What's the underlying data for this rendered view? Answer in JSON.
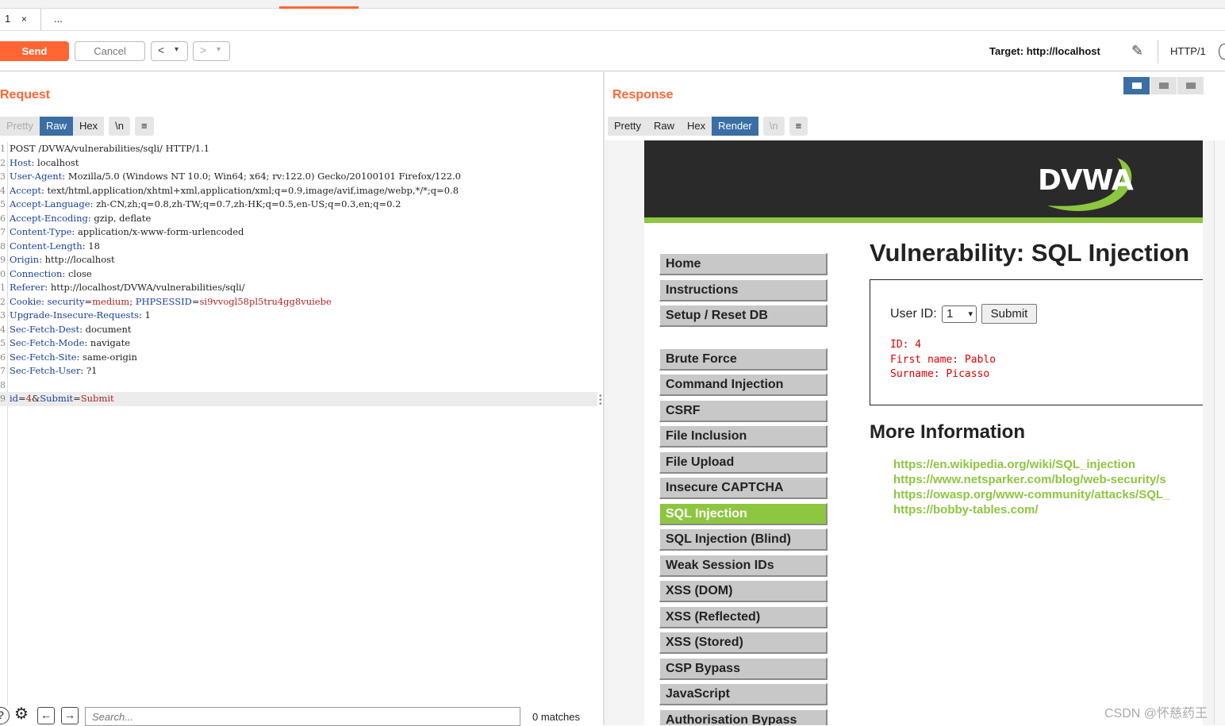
{
  "tabs": {
    "first_label": "1",
    "first_close": "×",
    "more_label": "..."
  },
  "toolbar": {
    "send_label": "Send",
    "cancel_label": "Cancel",
    "back_icon": "<",
    "back_dropdown": "▾",
    "forward_icon": ">",
    "forward_dropdown": "▾",
    "target_label": "Target: http://localhost",
    "pencil_icon": "✎",
    "http_version": "HTTP/1"
  },
  "request": {
    "title": "Request",
    "view_tabs": [
      "Pretty",
      "Raw",
      "Hex",
      "\\n",
      "≡"
    ],
    "lines": [
      {
        "n": "1",
        "name": "POST /DVWA/vulnerabilities/sqli/ HTTP/1.1",
        "sep": "",
        "value": ""
      },
      {
        "n": "2",
        "name": "Host",
        "sep": ": ",
        "value": "localhost"
      },
      {
        "n": "3",
        "name": "User-Agent",
        "sep": ": ",
        "value": "Mozilla/5.0 (Windows NT 10.0; Win64; x64; rv:122.0) Gecko/20100101 Firefox/122.0"
      },
      {
        "n": "4",
        "name": "Accept",
        "sep": ": ",
        "value": "text/html,application/xhtml+xml,application/xml;q=0.9,image/avif,image/webp,*/*;q=0.8"
      },
      {
        "n": "5",
        "name": "Accept-Language",
        "sep": ": ",
        "value": "zh-CN,zh;q=0.8,zh-TW;q=0.7,zh-HK;q=0.5,en-US;q=0.3,en;q=0.2"
      },
      {
        "n": "6",
        "name": "Accept-Encoding",
        "sep": ": ",
        "value": "gzip, deflate"
      },
      {
        "n": "7",
        "name": "Content-Type",
        "sep": ": ",
        "value": "application/x-www-form-urlencoded"
      },
      {
        "n": "8",
        "name": "Content-Length",
        "sep": ": ",
        "value": "18"
      },
      {
        "n": "9",
        "name": "Origin",
        "sep": ": ",
        "value": "http://localhost"
      },
      {
        "n": "0",
        "name": "Connection",
        "sep": ": ",
        "value": "close"
      },
      {
        "n": "1",
        "name": "Referer",
        "sep": ": ",
        "value": "http://localhost/DVWA/vulnerabilities/sqli/"
      },
      {
        "n": "2",
        "name": "Cookie",
        "sep": ": ",
        "value": "",
        "cookie": [
          "security",
          "=",
          "medium",
          "; ",
          "PHPSESSID",
          "=",
          "si9vvogl58pl5tru4gg8vuiebe"
        ]
      },
      {
        "n": "3",
        "name": "Upgrade-Insecure-Requests",
        "sep": ": ",
        "value": "1"
      },
      {
        "n": "4",
        "name": "Sec-Fetch-Dest",
        "sep": ": ",
        "value": "document"
      },
      {
        "n": "5",
        "name": "Sec-Fetch-Mode",
        "sep": ": ",
        "value": "navigate"
      },
      {
        "n": "6",
        "name": "Sec-Fetch-Site",
        "sep": ": ",
        "value": "same-origin"
      },
      {
        "n": "7",
        "name": "Sec-Fetch-User",
        "sep": ": ",
        "value": "?1"
      },
      {
        "n": "8",
        "name": "",
        "sep": "",
        "value": ""
      },
      {
        "n": "9",
        "name": "",
        "sep": "",
        "value": "",
        "body": [
          "id",
          "=",
          "4",
          "&",
          "Submit",
          "=",
          "Submit"
        ],
        "highlight": true
      }
    ]
  },
  "search": {
    "placeholder": "Search...",
    "matches": "0 matches"
  },
  "response": {
    "title": "Response",
    "view_tabs": [
      "Pretty",
      "Raw",
      "Hex",
      "Render",
      "\\n",
      "≡"
    ],
    "page": {
      "logo": "DVWA",
      "menu_top": [
        "Home",
        "Instructions",
        "Setup / Reset DB"
      ],
      "menu_modules": [
        "Brute Force",
        "Command Injection",
        "CSRF",
        "File Inclusion",
        "File Upload",
        "Insecure CAPTCHA",
        "SQL Injection",
        "SQL Injection (Blind)",
        "Weak Session IDs",
        "XSS (DOM)",
        "XSS (Reflected)",
        "XSS (Stored)",
        "CSP Bypass",
        "JavaScript",
        "Authorisation Bypass"
      ],
      "selected_module": "SQL Injection",
      "heading": "Vulnerability: SQL Injection",
      "user_id_label": "User ID:",
      "user_id_value": "1",
      "submit_label": "Submit",
      "result_lines": [
        "ID: 4",
        "First name: Pablo",
        "Surname: Picasso"
      ],
      "more_heading": "More Information",
      "links": [
        "https://en.wikipedia.org/wiki/SQL_injection",
        "https://www.netsparker.com/blog/web-security/s",
        "https://owasp.org/www-community/attacks/SQL_",
        "https://bobby-tables.com/"
      ]
    }
  },
  "watermark": "CSDN @怀慈药王",
  "colors": {
    "accent": "#ff6633",
    "active_tab": "#3a6ea5",
    "dvwa_green": "#8dc63f",
    "header_dark": "#2a2a2a",
    "result_red": "#dd0000"
  }
}
